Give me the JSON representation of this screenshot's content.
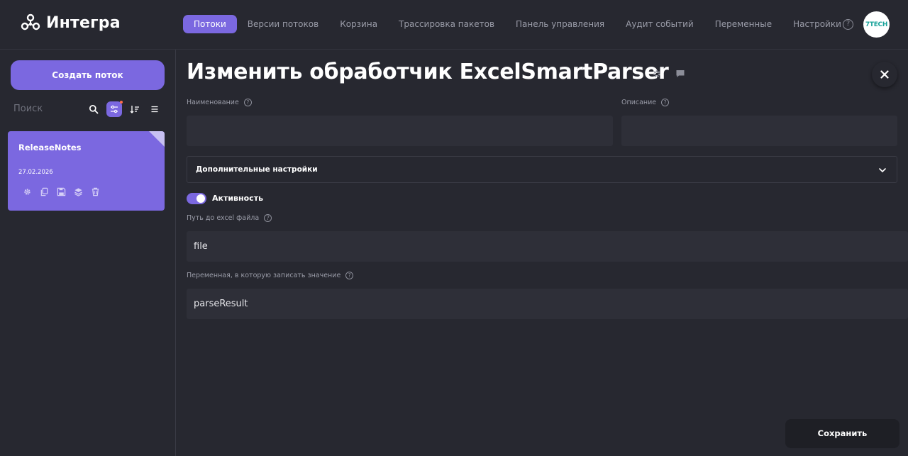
{
  "app": {
    "name": "Интегра",
    "avatar_text": "7TECH"
  },
  "nav": {
    "items": [
      {
        "label": "Потоки",
        "active": true
      },
      {
        "label": "Версии потоков",
        "active": false
      },
      {
        "label": "Корзина",
        "active": false
      },
      {
        "label": "Трассировка пакетов",
        "active": false
      },
      {
        "label": "Панель управления",
        "active": false
      },
      {
        "label": "Аудит событий",
        "active": false
      },
      {
        "label": "Переменные",
        "active": false
      },
      {
        "label": "Настройки",
        "active": false
      }
    ],
    "help_symbol": "?"
  },
  "sidebar": {
    "create_label": "Создать поток",
    "search_placeholder": "Поиск",
    "tools": [
      "search-icon",
      "filter-icon",
      "sort-icon",
      "list-icon"
    ],
    "cards": [
      {
        "title": "ReleaseNotes",
        "date": "27.02.2026",
        "actions": [
          "gear-icon",
          "copy-icon",
          "save-icon",
          "layers-icon",
          "trash-icon"
        ]
      }
    ]
  },
  "main": {
    "title": "Изменить обработчик ExcelSmartParser",
    "name_label": "Наименование",
    "name_value": "",
    "description_label": "Описание",
    "description_value": "",
    "advanced_label": "Дополнительные настройки",
    "activity_label": "Активность",
    "activity_on": true,
    "path_label": "Путь до excel файла",
    "path_value": "file",
    "variable_label": "Переменная, в которую записать значение",
    "variable_value": "parseResult",
    "save_label": "Сохранить"
  },
  "colors": {
    "accent": "#7b68e0",
    "background": "#272830",
    "input": "#2e2f38",
    "save_button": "#1e1f25"
  }
}
